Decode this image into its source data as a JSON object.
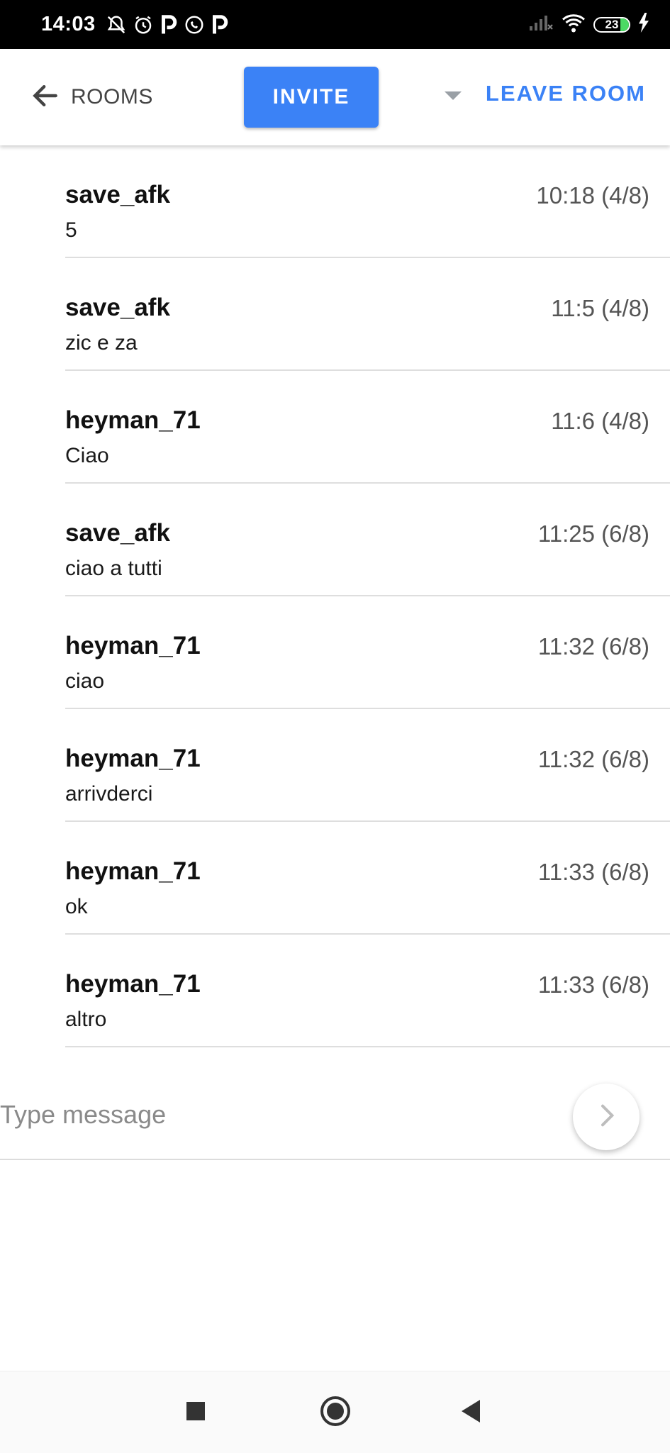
{
  "status_bar": {
    "time": "14:03",
    "battery": "23",
    "icons": [
      "muted-bell-icon",
      "alarm-icon",
      "p-app-icon",
      "whatsapp-icon",
      "p-app-icon",
      "signal-icon",
      "wifi-icon",
      "battery-icon",
      "charging-icon"
    ]
  },
  "header": {
    "back_label": "ROOMS",
    "invite_label": "INVITE",
    "leave_label": "LEAVE ROOM"
  },
  "messages": [
    {
      "sender": "save_afk",
      "text": "5",
      "time": "10:18 (4/8)"
    },
    {
      "sender": "save_afk",
      "text": "zic e za",
      "time": "11:5 (4/8)"
    },
    {
      "sender": "heyman_71",
      "text": "Ciao",
      "time": "11:6 (4/8)"
    },
    {
      "sender": "save_afk",
      "text": "ciao a tutti",
      "time": "11:25 (6/8)"
    },
    {
      "sender": "heyman_71",
      "text": "ciao",
      "time": "11:32 (6/8)"
    },
    {
      "sender": "heyman_71",
      "text": "arrivderci",
      "time": "11:32 (6/8)"
    },
    {
      "sender": "heyman_71",
      "text": "ok",
      "time": "11:33 (6/8)"
    },
    {
      "sender": "heyman_71",
      "text": "altro",
      "time": "11:33 (6/8)"
    }
  ],
  "composer": {
    "placeholder": "Type message",
    "value": ""
  },
  "colors": {
    "accent": "#3b82f6",
    "battery_fill": "#4cd964"
  }
}
